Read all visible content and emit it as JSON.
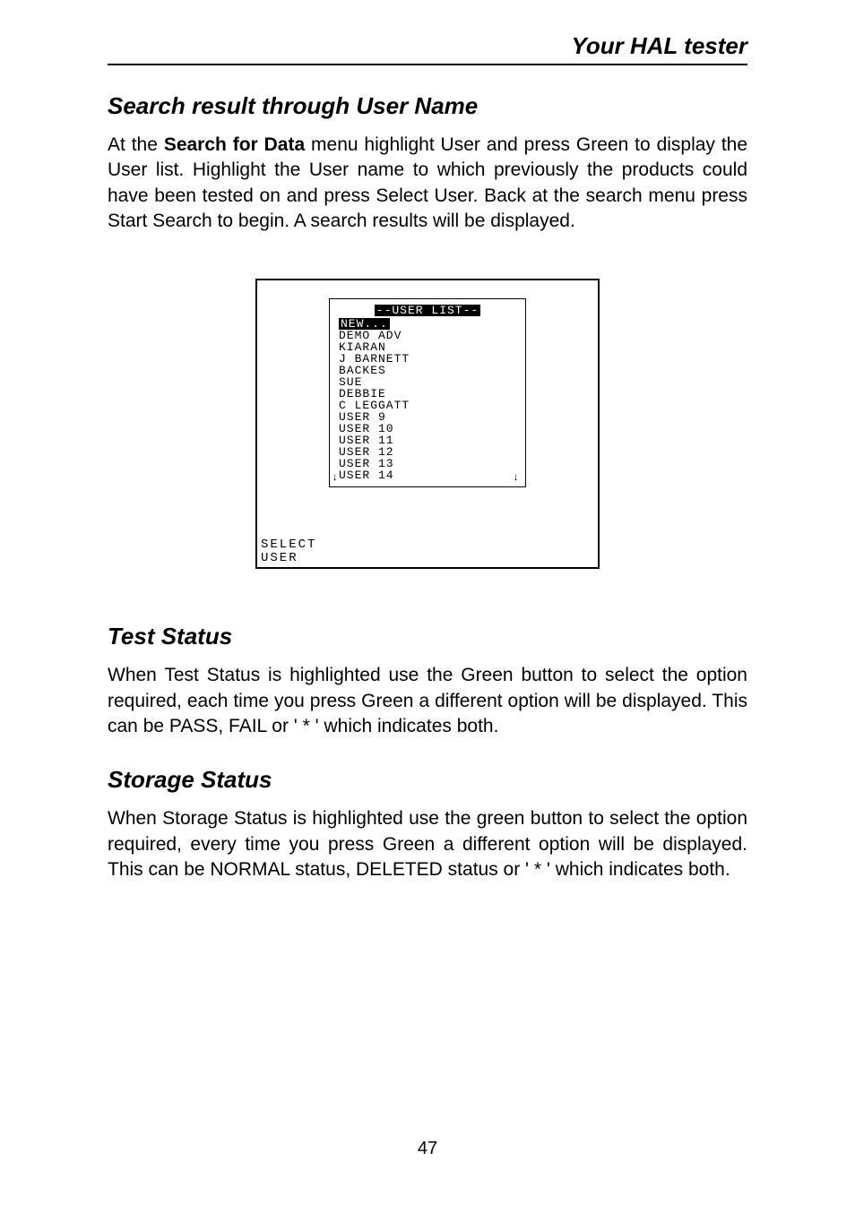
{
  "header": {
    "title": "Your HAL tester"
  },
  "section1": {
    "title": "Search result through User Name",
    "prefix": "At the ",
    "bold": "Search for Data",
    "rest": " menu highlight User and press Green to display the User list. Highlight the User name to which previously the products could have been tested on and press Select User. Back at the search menu press Start Search to begin. A search results will be displayed."
  },
  "screen": {
    "title": "--USER LIST--",
    "selected": "NEW...",
    "items": [
      "DEMO ADV",
      "KIARAN",
      "J BARNETT",
      "BACKES",
      "SUE",
      "DEBBIE",
      "C LEGGATT",
      "USER 9",
      "USER 10",
      "USER 11",
      "USER 12",
      "USER 13",
      "USER 14"
    ],
    "label_line1": "SELECT",
    "label_line2": "USER"
  },
  "section2": {
    "title": "Test Status",
    "text": "When Test Status is highlighted use the Green button to select the option required, each time you press Green a different option will be displayed. This can be PASS, FAIL or ' * ' which indicates both."
  },
  "section3": {
    "title": "Storage Status",
    "text": "When Storage Status is highlighted use the green button to select the option required, every time you press Green a different option will be displayed. This can be NORMAL status, DELETED status or ' * ' which indicates both."
  },
  "pageNumber": "47"
}
